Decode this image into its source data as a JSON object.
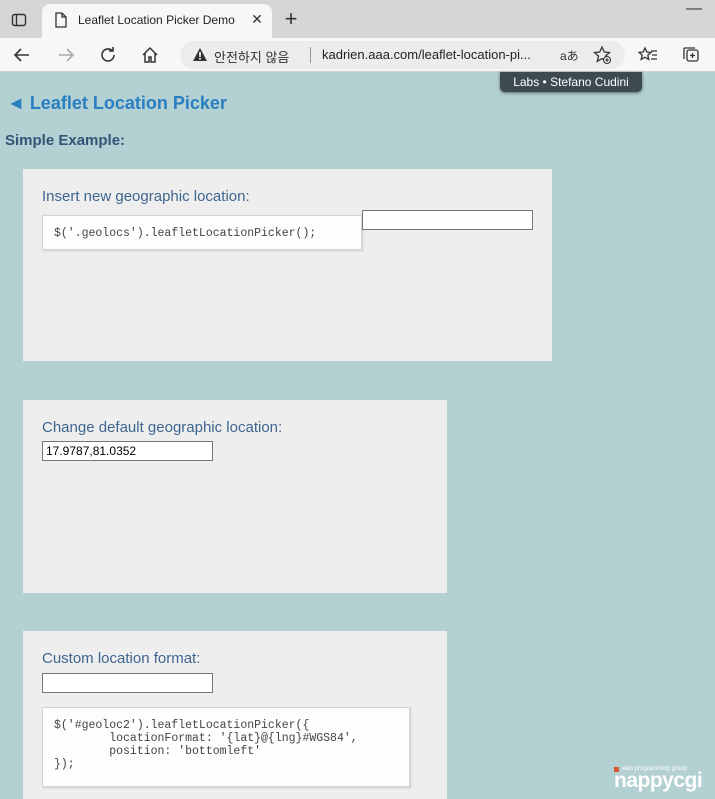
{
  "browser": {
    "tab_title": "Leaflet Location Picker Demo",
    "close_glyph": "✕",
    "newtab_glyph": "+",
    "minimize_glyph": "—",
    "not_secure": "안전하지 않음",
    "url": "kadrien.aaa.com/leaflet-location-pi...",
    "read_aloud": "aあ"
  },
  "page": {
    "labs_badge": "Labs • Stefano Cudini",
    "title": "◄ Leaflet Location Picker",
    "section": "Simple Example:"
  },
  "example1": {
    "label": "Insert new geographic location:",
    "code": "$('.geolocs').leafletLocationPicker();",
    "value": ""
  },
  "example2": {
    "label": "Change default geographic location:",
    "value": "17.9787,81.0352"
  },
  "example3": {
    "label": "Custom location format:",
    "value": "",
    "code": "$('#geoloc2').leafletLocationPicker({\n        locationFormat: '{lat}@{lng}#WGS84',\n        position: 'bottomleft'\n});"
  },
  "logo": {
    "tagline": "web programming group",
    "name": "nappycgi"
  }
}
